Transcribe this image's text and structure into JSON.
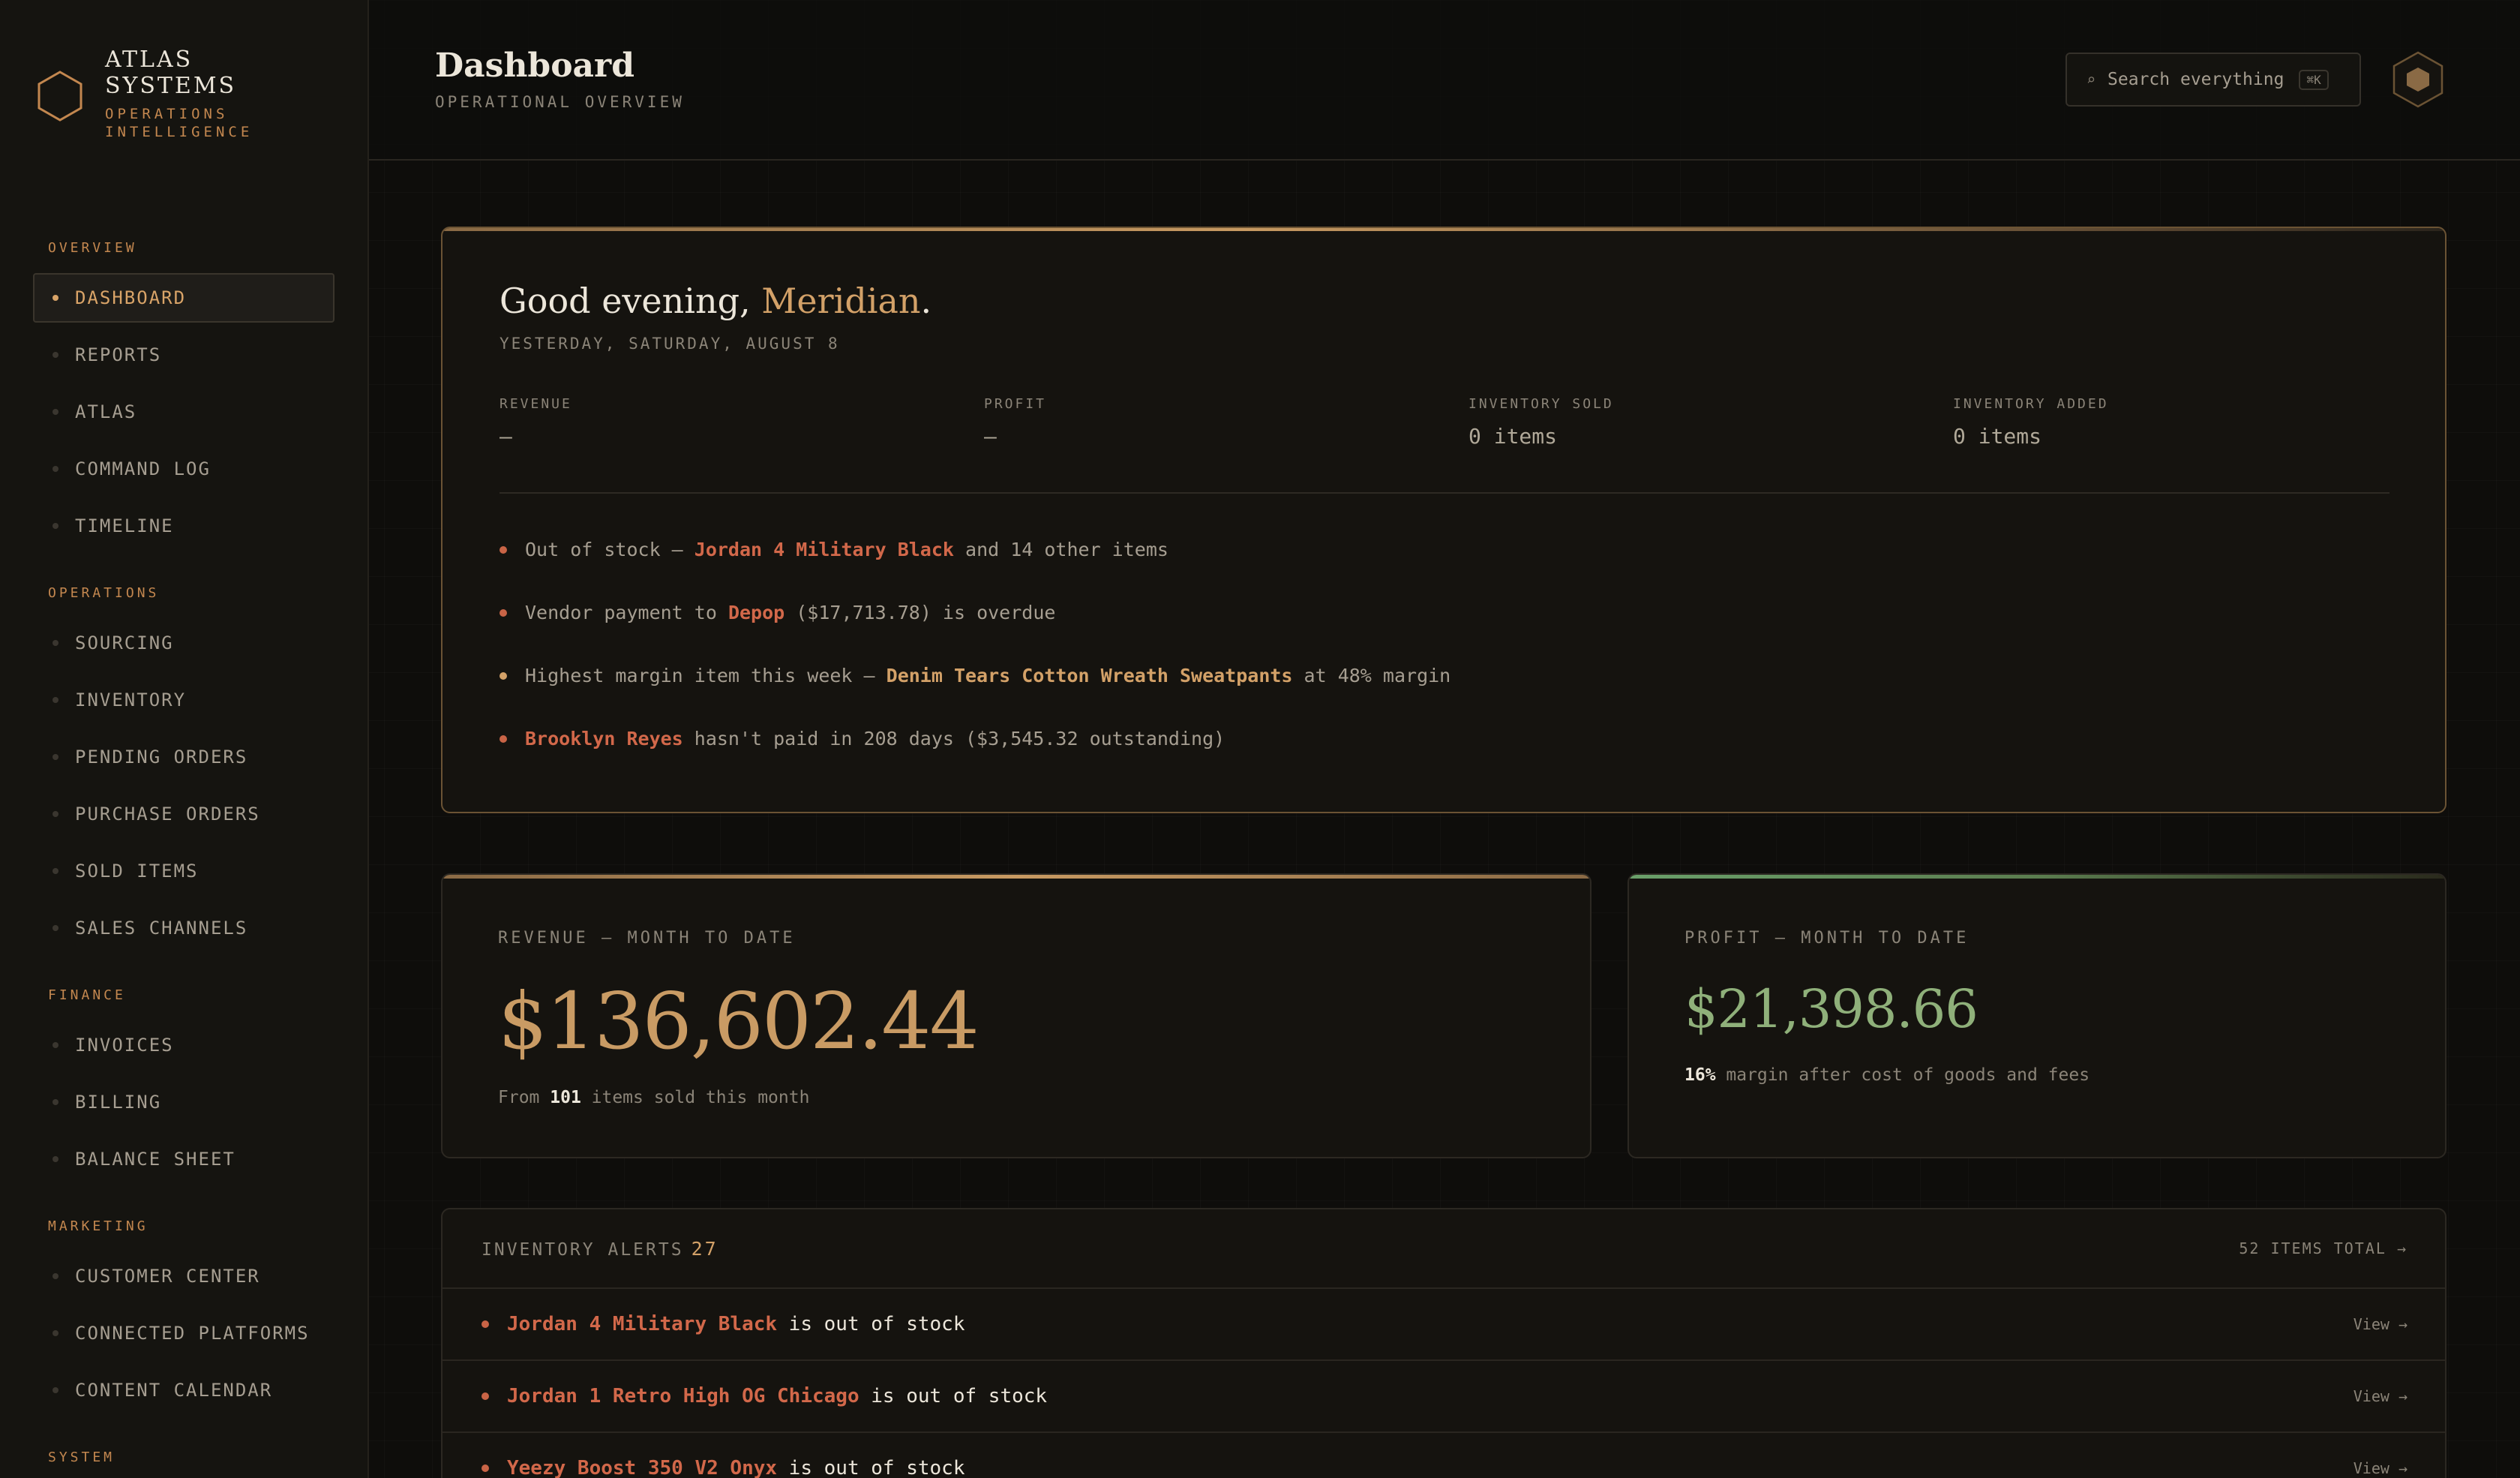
{
  "brand": {
    "name_line1": "ATLAS",
    "name_line2": "SYSTEMS",
    "tagline_line1": "OPERATIONS",
    "tagline_line2": "INTELLIGENCE"
  },
  "sidebar": {
    "sections": [
      {
        "title": "OVERVIEW",
        "items": [
          "DASHBOARD",
          "REPORTS",
          "ATLAS",
          "COMMAND LOG",
          "TIMELINE"
        ]
      },
      {
        "title": "OPERATIONS",
        "items": [
          "SOURCING",
          "INVENTORY",
          "PENDING ORDERS",
          "PURCHASE ORDERS",
          "SOLD ITEMS",
          "SALES CHANNELS"
        ]
      },
      {
        "title": "FINANCE",
        "items": [
          "INVOICES",
          "BILLING",
          "BALANCE SHEET"
        ]
      },
      {
        "title": "MARKETING",
        "items": [
          "CUSTOMER CENTER",
          "CONNECTED PLATFORMS",
          "CONTENT CALENDAR"
        ]
      },
      {
        "title": "SYSTEM",
        "items": []
      }
    ],
    "active_item": "DASHBOARD"
  },
  "header": {
    "title": "Dashboard",
    "subtitle": "OPERATIONAL OVERVIEW",
    "search_placeholder": "Search everything",
    "search_shortcut": "⌘K",
    "search_icon": "search-icon",
    "avatar_icon": "hexagon-avatar-icon"
  },
  "greeting": {
    "prefix": "Good evening, ",
    "name": "Meridian",
    "suffix": ".",
    "date": "YESTERDAY, SATURDAY, AUGUST 8",
    "stats": [
      {
        "label": "REVENUE",
        "value": "—"
      },
      {
        "label": "PROFIT",
        "value": "—"
      },
      {
        "label": "INVENTORY SOLD",
        "value": "0 items"
      },
      {
        "label": "INVENTORY ADDED",
        "value": "0 items"
      }
    ],
    "alerts": {
      "a1_pre": "Out of stock — ",
      "a1_hl": "Jordan 4 Military Black",
      "a1_post": " and 14 other items",
      "a2_pre": "Vendor payment to ",
      "a2_hl": "Depop",
      "a2_post": " ($17,713.78) is overdue",
      "a3_pre": "Highest margin item this week — ",
      "a3_hl": "Denim Tears Cotton Wreath Sweatpants",
      "a3_post": " at 48% margin",
      "a4_hl": "Brooklyn Reyes",
      "a4_post": " hasn't paid in 208 days ($3,545.32 outstanding)"
    }
  },
  "revenue_card": {
    "label": "REVENUE — MONTH TO DATE",
    "value": "$136,602.44",
    "foot_pre": "From ",
    "foot_num": "101",
    "foot_post": " items sold this month"
  },
  "profit_card": {
    "label": "PROFIT — MONTH TO DATE",
    "value": "$21,398.66",
    "foot_num": "16%",
    "foot_post": " margin after cost of goods and fees"
  },
  "inventory_alerts": {
    "title": "INVENTORY ALERTS",
    "count": "27",
    "total_link": "52 ITEMS TOTAL →",
    "rows": [
      {
        "item": "Jordan 4 Military Black",
        "status": " is out of stock",
        "action": "View →"
      },
      {
        "item": "Jordan 1 Retro High OG Chicago",
        "status": " is out of stock",
        "action": "View →"
      },
      {
        "item": "Yeezy Boost 350 V2 Onyx",
        "status": " is out of stock",
        "action": "View →"
      }
    ]
  },
  "colors": {
    "accent_gold": "#d3a168",
    "alert_red": "#d2684a",
    "profit_green": "#8fb07a",
    "background": "#0e0d0b"
  }
}
